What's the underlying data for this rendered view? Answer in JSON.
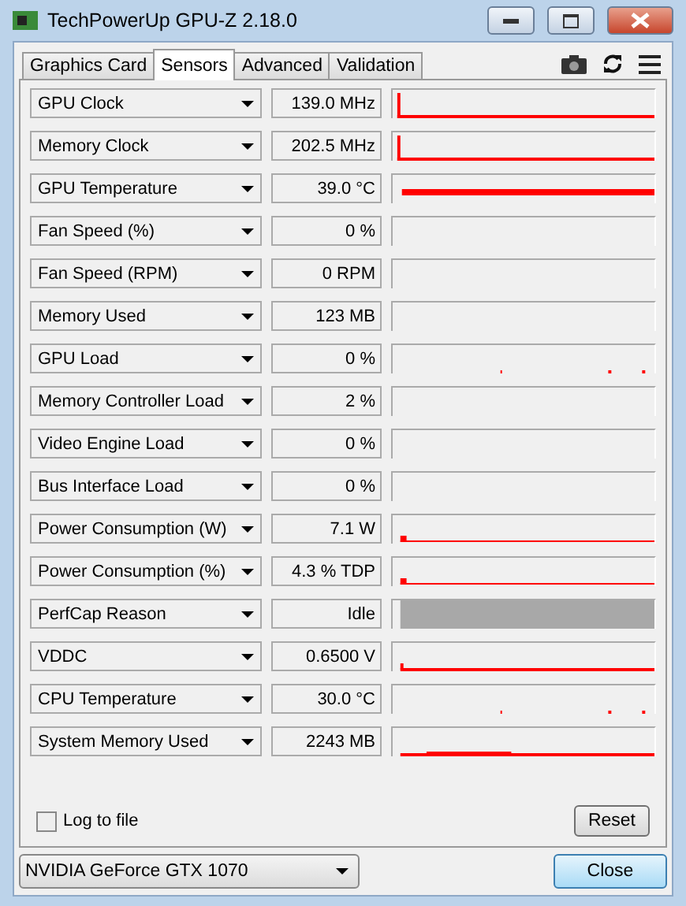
{
  "window": {
    "title": "TechPowerUp GPU-Z 2.18.0"
  },
  "tabs": [
    {
      "label": "Graphics Card",
      "selected": false
    },
    {
      "label": "Sensors",
      "selected": true
    },
    {
      "label": "Advanced",
      "selected": false
    },
    {
      "label": "Validation",
      "selected": false
    }
  ],
  "sensors": [
    {
      "name": "GPU Clock",
      "value": "139.0 MHz",
      "kind": "spike"
    },
    {
      "name": "Memory Clock",
      "value": "202.5 MHz",
      "kind": "spike"
    },
    {
      "name": "GPU Temperature",
      "value": "39.0 °C",
      "kind": "flat"
    },
    {
      "name": "Fan Speed (%)",
      "value": "0 %",
      "kind": "empty"
    },
    {
      "name": "Fan Speed (RPM)",
      "value": "0 RPM",
      "kind": "empty"
    },
    {
      "name": "Memory Used",
      "value": "123 MB",
      "kind": "empty"
    },
    {
      "name": "GPU Load",
      "value": "0 %",
      "kind": "dots"
    },
    {
      "name": "Memory Controller Load",
      "value": "2 %",
      "kind": "empty"
    },
    {
      "name": "Video Engine Load",
      "value": "0 %",
      "kind": "empty"
    },
    {
      "name": "Bus Interface Load",
      "value": "0 %",
      "kind": "empty"
    },
    {
      "name": "Power Consumption (W)",
      "value": "7.1 W",
      "kind": "low"
    },
    {
      "name": "Power Consumption (%)",
      "value": "4.3 % TDP",
      "kind": "low"
    },
    {
      "name": "PerfCap Reason",
      "value": "Idle",
      "kind": "bar"
    },
    {
      "name": "VDDC",
      "value": "0.6500 V",
      "kind": "base"
    },
    {
      "name": "CPU Temperature",
      "value": "30.0 °C",
      "kind": "dots"
    },
    {
      "name": "System Memory Used",
      "value": "2243 MB",
      "kind": "bump"
    }
  ],
  "log_to_file": {
    "label": "Log to file",
    "checked": false
  },
  "reset_button": "Reset",
  "gpu_select": "NVIDIA GeForce GTX 1070",
  "close_button": "Close"
}
